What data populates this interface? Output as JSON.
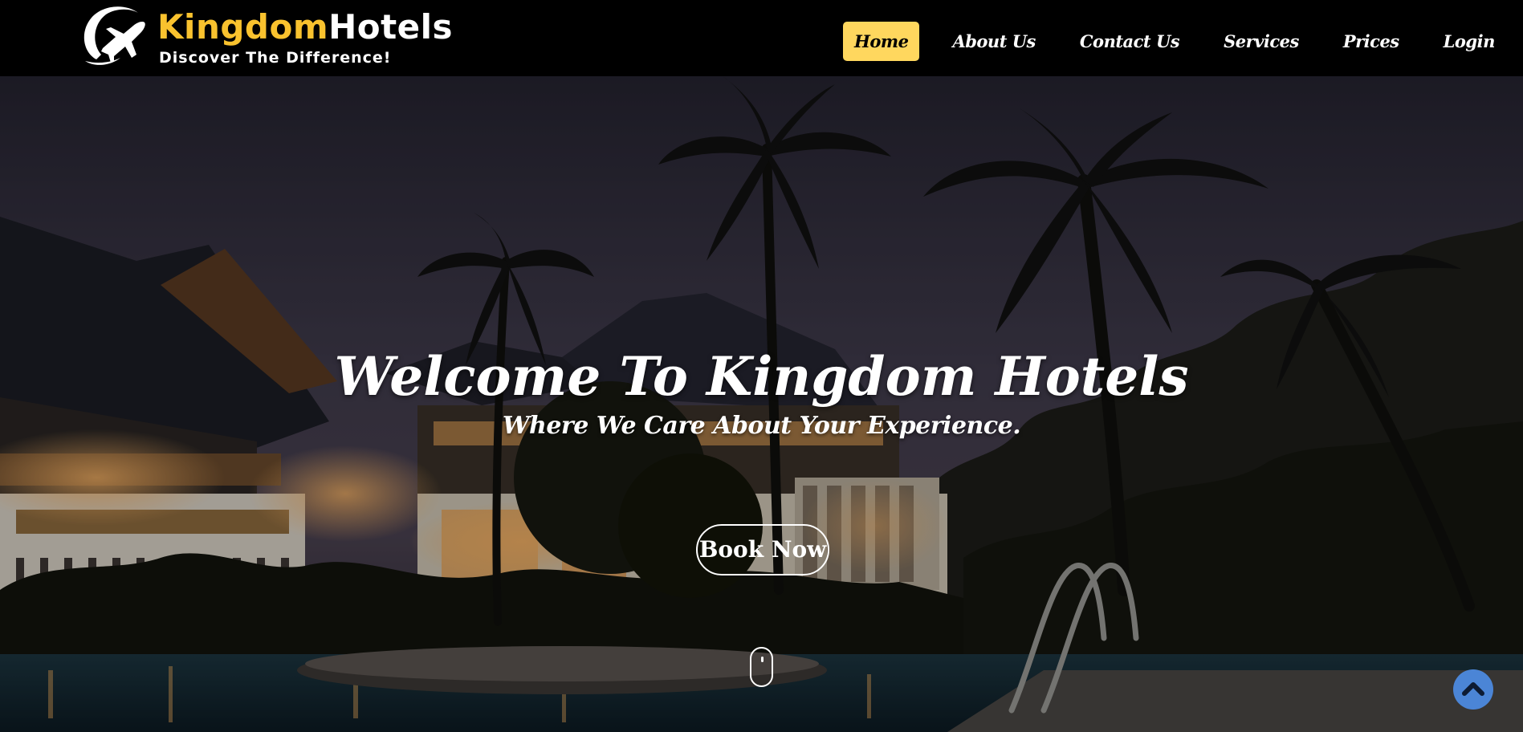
{
  "brand": {
    "name_part1": "Kingdom",
    "name_part2": "Hotels",
    "tagline": "Discover The Difference!",
    "logo_icon": "plane-logo-icon",
    "colors": {
      "accent": "#f9c22e",
      "text": "#ffffff",
      "header_bg": "#000000"
    }
  },
  "nav": {
    "items": [
      {
        "label": "Home",
        "active": true
      },
      {
        "label": "About Us",
        "active": false
      },
      {
        "label": "Contact Us",
        "active": false
      },
      {
        "label": "Services",
        "active": false
      },
      {
        "label": "Prices",
        "active": false
      },
      {
        "label": "Login",
        "active": false
      }
    ],
    "active_color": "#ffd75e"
  },
  "hero": {
    "title": "Welcome To Kingdom Hotels",
    "subtitle": "Where We Care About Your Experience.",
    "cta_label": "Book Now",
    "scroll_icon": "mouse-scroll-icon"
  },
  "back_to_top": {
    "icon": "chevron-up-icon",
    "color": "#4b85d6"
  }
}
